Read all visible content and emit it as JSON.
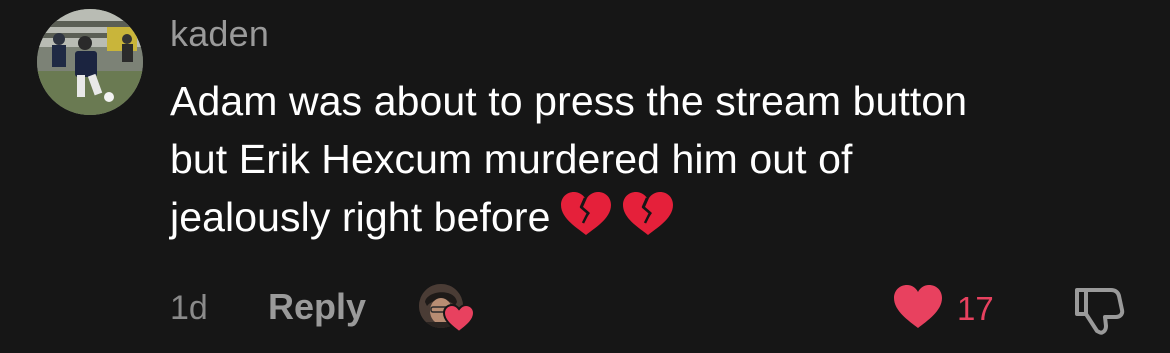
{
  "comment": {
    "username": "kaden",
    "lines": [
      "Adam was about to press the stream button",
      "but Erik Hexcum murdered him out of",
      "jealously right before"
    ],
    "emojis": [
      "broken-heart",
      "broken-heart"
    ],
    "timestamp": "1d",
    "reply_label": "Reply",
    "like_count": "17",
    "creator_liked": true
  },
  "colors": {
    "background": "#161616",
    "username": "#9a9a9a",
    "text": "#ffffff",
    "meta": "#8a8a8a",
    "like": "#e8415f"
  },
  "icons": {
    "avatar": "user-avatar",
    "creator": "creator-liked-avatar",
    "like": "heart-icon",
    "dislike": "thumbs-down-icon"
  }
}
